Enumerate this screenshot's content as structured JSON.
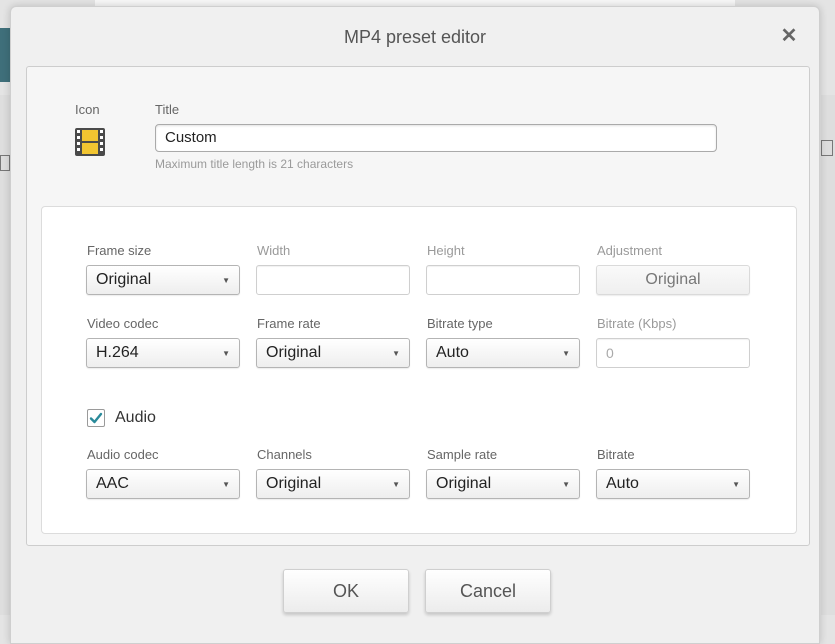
{
  "dialog": {
    "title": "MP4 preset editor",
    "close_icon": "close-icon"
  },
  "header": {
    "icon_label": "Icon",
    "icon_name": "film-icon",
    "title_label": "Title",
    "title_value": "Custom",
    "title_hint": "Maximum title length is 21 characters"
  },
  "video": {
    "frame_size_label": "Frame size",
    "frame_size_value": "Original",
    "width_label": "Width",
    "width_value": "",
    "height_label": "Height",
    "height_value": "",
    "adjustment_label": "Adjustment",
    "adjustment_value": "Original",
    "codec_label": "Video codec",
    "codec_value": "H.264",
    "frame_rate_label": "Frame rate",
    "frame_rate_value": "Original",
    "bitrate_type_label": "Bitrate type",
    "bitrate_type_value": "Auto",
    "bitrate_label": "Bitrate (Kbps)",
    "bitrate_value": "0"
  },
  "audio": {
    "enabled_label": "Audio",
    "enabled": true,
    "codec_label": "Audio codec",
    "codec_value": "AAC",
    "channels_label": "Channels",
    "channels_value": "Original",
    "sample_rate_label": "Sample rate",
    "sample_rate_value": "Original",
    "bitrate_label": "Bitrate",
    "bitrate_value": "Auto"
  },
  "buttons": {
    "ok": "OK",
    "cancel": "Cancel"
  },
  "colors": {
    "check_accent": "#2a8a9a",
    "film_fill": "#f2c531"
  }
}
